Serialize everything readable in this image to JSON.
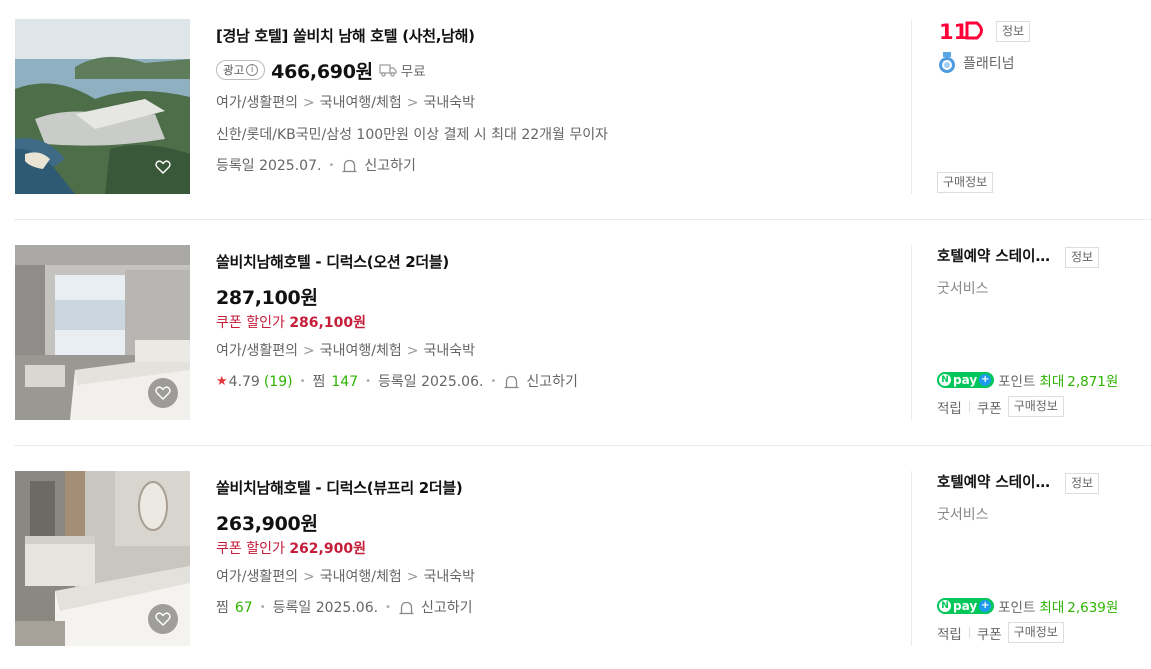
{
  "products": [
    {
      "title": "[경남 호텔] 쏠비치 남해 호텔 (사천,남해)",
      "ad_label": "광고",
      "ad_info_icon": "info-circle-icon",
      "price": "466,690원",
      "shipping_icon": "truck-icon",
      "shipping": "무료",
      "category": [
        "여가/생활편의",
        "국내여행/체험",
        "국내숙박"
      ],
      "category_sep": ">",
      "description": "신한/롯데/KB국민/삼성 100만원 이상 결제 시 최대 22개월 무이자",
      "registered": "등록일 2025.07.",
      "report": "신고하기",
      "mall_logo_text": "11",
      "mall_info_btn": "정보",
      "grade": "플래티넘",
      "buy_info_btn": "구매정보"
    },
    {
      "title": "쏠비치남해호텔 - 디럭스(오션 2더블)",
      "price": "287,100원",
      "coupon_label": "쿠폰 할인가",
      "coupon_price": "286,100원",
      "category": [
        "여가/생활편의",
        "국내여행/체험",
        "국내숙박"
      ],
      "rating": "4.79",
      "review_count": "(19)",
      "zzim_label": "찜",
      "zzim_count": "147",
      "registered": "등록일 2025.06.",
      "report": "신고하기",
      "mall_name": "호텔예약 스테이월드",
      "mall_info_btn": "정보",
      "mall_grade": "굿서비스",
      "npay_label": "pay",
      "points_label": "포인트",
      "points_max": "최대",
      "points_amount": "2,871원",
      "earn_label": "적립",
      "coupon_tag": "쿠폰",
      "buy_info_btn": "구매정보"
    },
    {
      "title": "쏠비치남해호텔 - 디럭스(뷰프리 2더블)",
      "price": "263,900원",
      "coupon_label": "쿠폰 할인가",
      "coupon_price": "262,900원",
      "category": [
        "여가/생활편의",
        "국내여행/체험",
        "국내숙박"
      ],
      "zzim_label": "찜",
      "zzim_count": "67",
      "registered": "등록일 2025.06.",
      "report": "신고하기",
      "mall_name": "호텔예약 스테이월드",
      "mall_info_btn": "정보",
      "mall_grade": "굿서비스",
      "npay_label": "pay",
      "points_label": "포인트",
      "points_max": "최대",
      "points_amount": "2,639원",
      "earn_label": "적립",
      "coupon_tag": "쿠폰",
      "buy_info_btn": "구매정보"
    }
  ],
  "colors": {
    "coupon_red": "#c51e3a",
    "green": "#2db400",
    "npay_green": "#03c75a",
    "eleven_st_red": "#ff0038"
  }
}
